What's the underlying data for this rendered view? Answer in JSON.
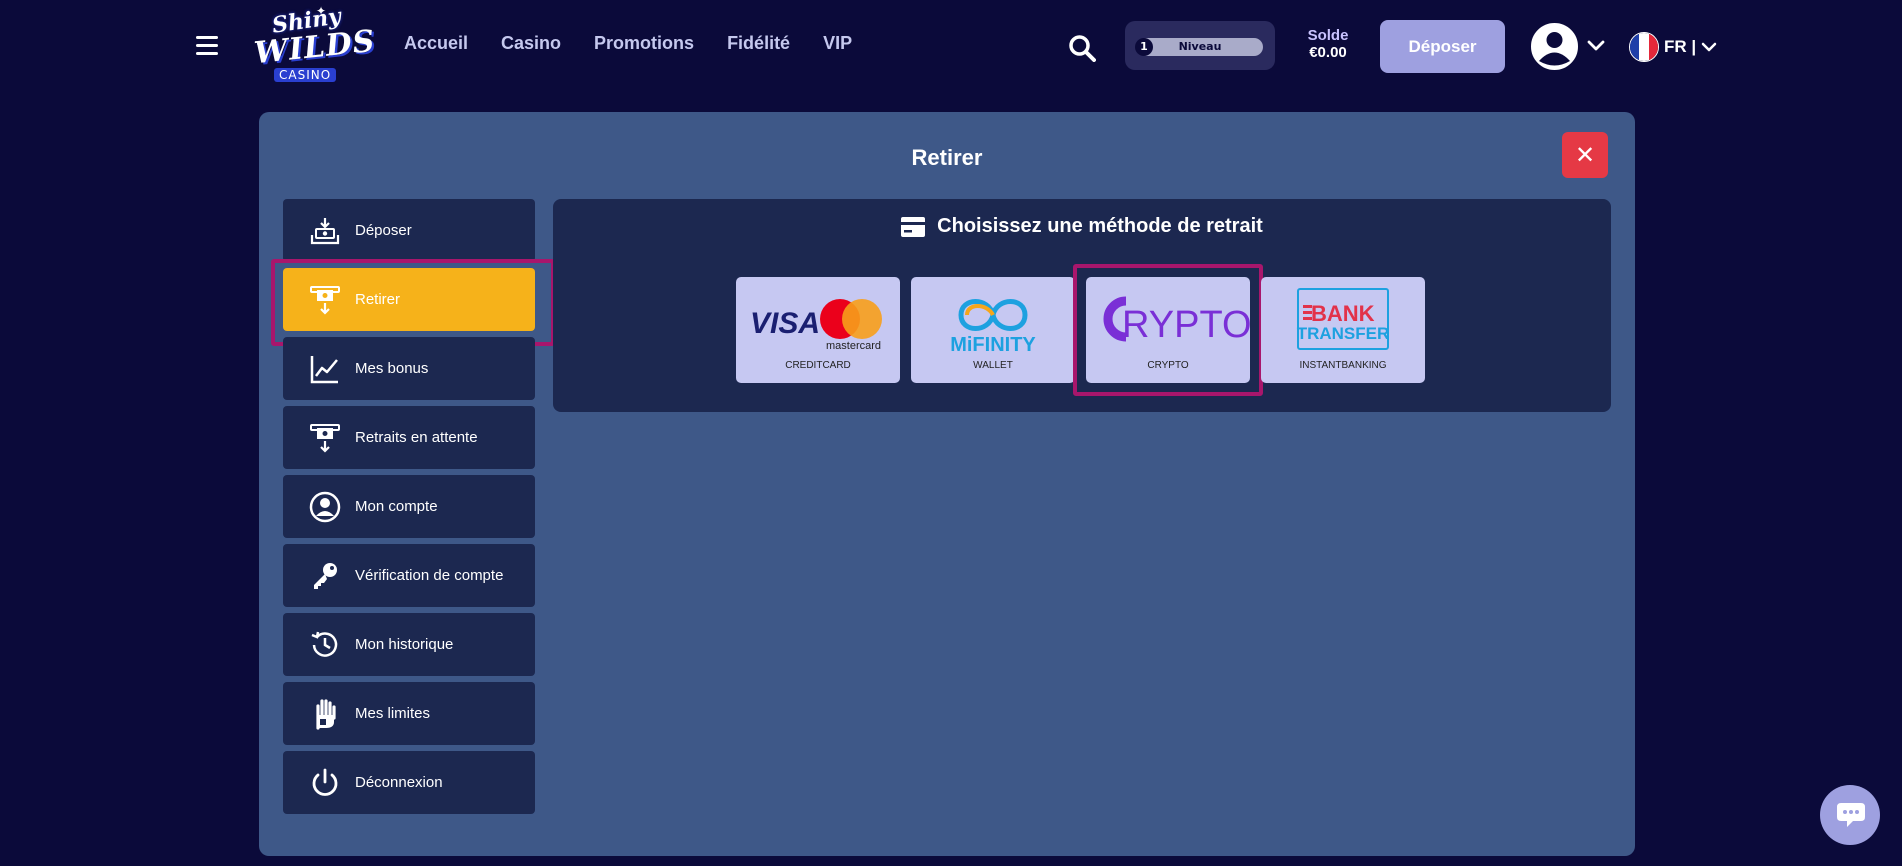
{
  "header": {
    "logo": {
      "line1": "Shiny",
      "line2": "WILDS",
      "line3": "CASINO"
    },
    "nav": [
      "Accueil",
      "Casino",
      "Promotions",
      "Fidélité",
      "VIP"
    ],
    "level": {
      "number": "1",
      "label": "Niveau",
      "progress": 0
    },
    "balance": {
      "label": "Solde",
      "value": "€0.00"
    },
    "deposit_label": "Déposer",
    "language": "FR |"
  },
  "modal": {
    "title": "Retirer",
    "close_label": "✕",
    "sidebar": [
      {
        "label": "Déposer",
        "icon": "deposit-icon"
      },
      {
        "label": "Retirer",
        "icon": "withdraw-icon",
        "active": true
      },
      {
        "label": "Mes bonus",
        "icon": "chart-line-icon"
      },
      {
        "label": "Retraits en attente",
        "icon": "pending-withdraw-icon"
      },
      {
        "label": "Mon compte",
        "icon": "user-circle-icon"
      },
      {
        "label": "Vérification de compte",
        "icon": "key-icon"
      },
      {
        "label": "Mon historique",
        "icon": "history-icon"
      },
      {
        "label": "Mes limites",
        "icon": "hand-icon"
      },
      {
        "label": "Déconnexion",
        "icon": "power-icon"
      }
    ],
    "panel": {
      "title": "Choisissez une méthode de retrait",
      "methods": [
        {
          "caption": "CREDITCARD",
          "logo_visa": "VISA",
          "logo_mc": "mastercard"
        },
        {
          "caption": "WALLET",
          "logo": "MiFINITY"
        },
        {
          "caption": "CRYPTO",
          "logo": "RYPTO",
          "selected": true
        },
        {
          "caption": "INSTANTBANKING",
          "logo1": "BANK",
          "logo2": "TRANSFER"
        }
      ]
    }
  },
  "colors": {
    "background": "#0b0a3a",
    "modal": "#3e5888",
    "panel": "#1c2850",
    "active": "#f6b21a",
    "highlight": "#a8166c",
    "close": "#e53945",
    "button": "#9ea0e0"
  }
}
